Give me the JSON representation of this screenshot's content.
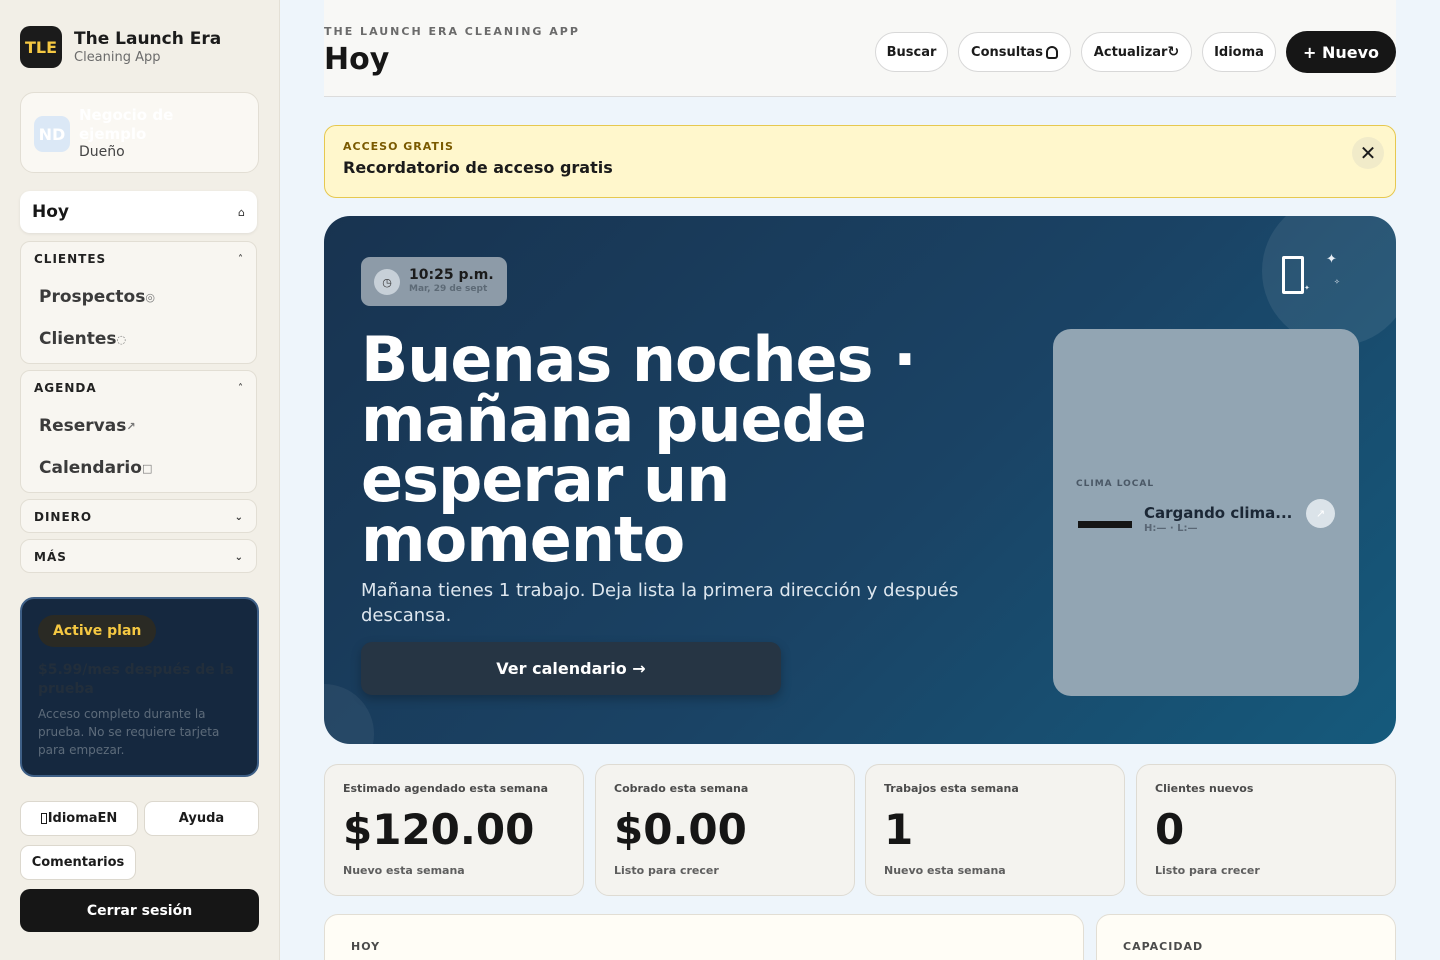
{
  "brand": {
    "logo": "TLE",
    "title": "The Launch Era",
    "subtitle": "Cleaning App"
  },
  "business": {
    "avatar": "ND",
    "name": "Negocio de ejemplo",
    "role": "Dueño"
  },
  "nav": {
    "today": {
      "label": "Hoy",
      "icon": "⌂"
    },
    "groups": [
      {
        "label": "CLIENTES",
        "chevron": "˄",
        "items": [
          {
            "label": "Prospectos",
            "icon": "◎"
          },
          {
            "label": "Clientes",
            "icon": "◌"
          }
        ]
      },
      {
        "label": "AGENDA",
        "chevron": "˄",
        "items": [
          {
            "label": "Reservas",
            "icon": "↗"
          },
          {
            "label": "Calendario",
            "icon": "□"
          }
        ]
      },
      {
        "label": "DINERO",
        "chevron": "⌄"
      },
      {
        "label": "MÁS",
        "chevron": "⌄"
      }
    ]
  },
  "plan": {
    "badge": "Active plan",
    "price": "$5.99/mes después de la prueba",
    "description": "Acceso completo durante la prueba. No se requiere tarjeta para empezar."
  },
  "sidebar_buttons": {
    "language": "IdiomaEN",
    "help": "Ayuda",
    "feedback": "Comentarios",
    "logout": "Cerrar sesión"
  },
  "header": {
    "eyebrow": "THE LAUNCH ERA CLEANING APP",
    "title": "Hoy",
    "buttons": {
      "search": "Buscar",
      "inquiries": "Consultas",
      "refresh": "Actualizar",
      "language": "Idioma",
      "new": "+ Nuevo"
    }
  },
  "banner": {
    "eyebrow": "ACCESO GRATIS",
    "text": "Recordatorio de acceso gratis",
    "close": "✕"
  },
  "hero": {
    "time": "10:25 p.m.",
    "date": "Mar, 29 de sept",
    "title": "Buenas noches · mañana puede esperar un momento",
    "subtitle": "Mañana tienes 1 trabajo. Deja lista la primera dirección y después descansa.",
    "cta": "Ver calendario →",
    "weather": {
      "label": "CLIMA LOCAL",
      "status": "Cargando clima...",
      "hilo": "H:— · L:—"
    }
  },
  "stats": [
    {
      "label": "Estimado agendado esta semana",
      "value": "$120.00",
      "note": "Nuevo esta semana"
    },
    {
      "label": "Cobrado esta semana",
      "value": "$0.00",
      "note": "Listo para crecer"
    },
    {
      "label": "Trabajos esta semana",
      "value": "1",
      "note": "Nuevo esta semana"
    },
    {
      "label": "Clientes nuevos",
      "value": "0",
      "note": "Listo para crecer"
    }
  ],
  "panels": {
    "today": "HOY",
    "capacity": "CAPACIDAD"
  },
  "colors": {
    "accent": "#f5c842",
    "hero": "#1a4365",
    "banner": "#fff7cc",
    "dark": "#161616"
  }
}
